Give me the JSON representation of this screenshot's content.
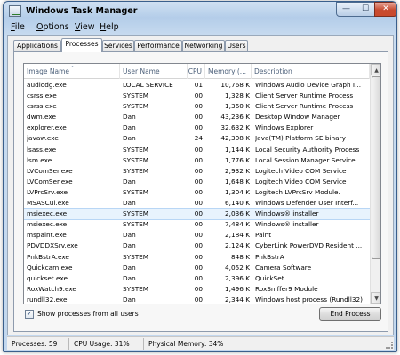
{
  "window": {
    "title": "Windows Task Manager",
    "caption_buttons": {
      "minimize": "—",
      "maximize": "☐",
      "close": "✕"
    }
  },
  "menu": [
    {
      "label": "File",
      "key": "F",
      "rest": "ile"
    },
    {
      "label": "Options",
      "key": "O",
      "rest": "ptions"
    },
    {
      "label": "View",
      "key": "V",
      "rest": "iew"
    },
    {
      "label": "Help",
      "key": "H",
      "rest": "elp"
    }
  ],
  "tabs": [
    "Applications",
    "Processes",
    "Services",
    "Performance",
    "Networking",
    "Users"
  ],
  "active_tab": "Processes",
  "table": {
    "columns": [
      "Image Name",
      "User Name",
      "CPU",
      "Memory (...",
      "Description"
    ],
    "sort_indicator": "^",
    "rows": [
      [
        "audiodg.exe",
        "LOCAL SERVICE",
        "01",
        "10,768 K",
        "Windows Audio Device Graph I..."
      ],
      [
        "csrss.exe",
        "SYSTEM",
        "00",
        "1,328 K",
        "Client Server Runtime Process"
      ],
      [
        "csrss.exe",
        "SYSTEM",
        "00",
        "1,360 K",
        "Client Server Runtime Process"
      ],
      [
        "dwm.exe",
        "Dan",
        "00",
        "43,236 K",
        "Desktop Window Manager"
      ],
      [
        "explorer.exe",
        "Dan",
        "00",
        "32,632 K",
        "Windows Explorer"
      ],
      [
        "javaw.exe",
        "Dan",
        "24",
        "42,308 K",
        "Java(TM) Platform SE binary"
      ],
      [
        "lsass.exe",
        "SYSTEM",
        "00",
        "1,144 K",
        "Local Security Authority Process"
      ],
      [
        "lsm.exe",
        "SYSTEM",
        "00",
        "1,776 K",
        "Local Session Manager Service"
      ],
      [
        "LVComSer.exe",
        "SYSTEM",
        "00",
        "2,932 K",
        "Logitech Video COM Service"
      ],
      [
        "LVComSer.exe",
        "Dan",
        "00",
        "1,648 K",
        "Logitech Video COM Service"
      ],
      [
        "LVPrcSrv.exe",
        "SYSTEM",
        "00",
        "1,304 K",
        "Logitech LVPrcSrv Module."
      ],
      [
        "MSASCui.exe",
        "Dan",
        "00",
        "6,140 K",
        "Windows Defender User Interf..."
      ],
      [
        "msiexec.exe",
        "SYSTEM",
        "00",
        "2,036 K",
        "Windows® installer"
      ],
      [
        "msiexec.exe",
        "SYSTEM",
        "00",
        "7,484 K",
        "Windows® installer"
      ],
      [
        "mspaint.exe",
        "Dan",
        "00",
        "2,184 K",
        "Paint"
      ],
      [
        "PDVDDXSrv.exe",
        "Dan",
        "00",
        "2,124 K",
        "CyberLink PowerDVD Resident ..."
      ],
      [
        "PnkBstrA.exe",
        "SYSTEM",
        "00",
        "848 K",
        "PnkBstrA"
      ],
      [
        "Quickcam.exe",
        "Dan",
        "00",
        "4,052 K",
        "Camera Software"
      ],
      [
        "quickset.exe",
        "Dan",
        "00",
        "2,396 K",
        "QuickSet"
      ],
      [
        "RoxWatch9.exe",
        "SYSTEM",
        "00",
        "1,496 K",
        "RoxSniffer9 Module"
      ],
      [
        "rundll32.exe",
        "Dan",
        "00",
        "2,344 K",
        "Windows host process (Rundll32)"
      ]
    ],
    "selected_index": 12
  },
  "show_all": {
    "label": "Show processes from all users",
    "checked_glyph": "✓"
  },
  "end_button": "End Process",
  "status": {
    "processes": "Processes: 59",
    "cpu": "CPU Usage: 31%",
    "memory": "Physical Memory: 34%"
  },
  "colors": {
    "title_bar": "#c2d7ee",
    "close_button": "#c84a2f",
    "selected_row": "#e8f3fd"
  }
}
